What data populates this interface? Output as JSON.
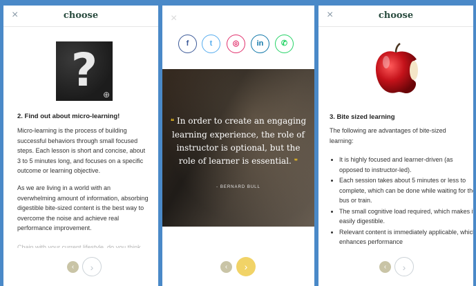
{
  "panel1": {
    "close_icon": "×",
    "title": "choose",
    "heading": "2. Find out about micro-learning!",
    "paragraphs": [
      "Micro-learning is the process of building successful behaviors through small focused steps. Each lesson is short and concise, about 3 to 5 minutes long, and focuses on a specific outcome or learning objective.",
      "As we are living in a world with an overwhelming amount of information, absorbing digestible bite-sized content is the best way to overcome the noise and achieve real performance improvement."
    ],
    "faded_text": "Chain with your current lifestyle, do you think",
    "prev_icon": "‹",
    "next_icon": "›"
  },
  "panel2": {
    "close_icon": "×",
    "social": [
      {
        "label": "f",
        "name": "facebook-icon",
        "color": "#3b5998"
      },
      {
        "label": "t",
        "name": "twitter-icon",
        "color": "#55acee"
      },
      {
        "label": "◎",
        "name": "instagram-icon",
        "color": "#e1306c"
      },
      {
        "label": "in",
        "name": "linkedin-icon",
        "color": "#0e76a8"
      },
      {
        "label": "✆",
        "name": "whatsapp-icon",
        "color": "#25d366"
      }
    ],
    "quote": "In order to create an engaging learning experience, the role of instructor is optional, but the role of learner is essential.",
    "open_quote": "❝",
    "close_quote": "❞",
    "author": "- BERNARD BULL",
    "prev_icon": "‹",
    "next_icon": "›"
  },
  "panel3": {
    "close_icon": "×",
    "title": "choose",
    "heading": "3. Bite sized learning",
    "intro": "The following are advantages of bite-sized learning:",
    "bullets": [
      "It is highly focused and learner-driven (as opposed to instructor-led).",
      "Each session takes about 5 minutes or less to complete, which can be done while waiting for the bus or train.",
      "The small cognitive load required, which makes it easily digestible.",
      "Relevant content is immediately applicable, which enhances performance"
    ],
    "prev_icon": "‹",
    "next_icon": "›"
  },
  "colors": {
    "background": "#4a89c8",
    "title": "#2b4d40",
    "accent_yellow": "#f1d367",
    "prev_button": "#c9c4a6"
  }
}
